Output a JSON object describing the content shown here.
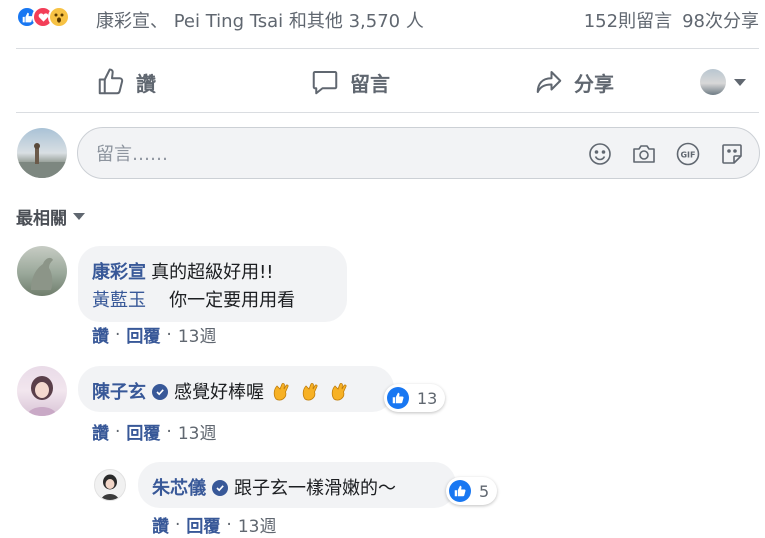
{
  "reactions": {
    "icons": [
      "like-icon",
      "love-icon",
      "wow-icon"
    ],
    "reactors_text": "康彩宣、 Pei Ting Tsai 和其他 3,570 人",
    "comments_count": "152則留言",
    "shares_count": "98次分享"
  },
  "actions": {
    "like": "讚",
    "comment": "留言",
    "share": "分享"
  },
  "composer": {
    "placeholder": "留言……"
  },
  "sort": {
    "label": "最相關"
  },
  "comments": [
    {
      "author": "康彩宣",
      "text": "真的超級好用!!",
      "mention": "黃藍玉",
      "mention_text": "你一定要用用看",
      "like_label": "讚",
      "reply_label": "回覆",
      "time": "13週"
    },
    {
      "author": "陳子玄",
      "verified": true,
      "text": "感覺好棒喔",
      "emoji": "clapping-hands-icon",
      "reactions_count": "13",
      "like_label": "讚",
      "reply_label": "回覆",
      "time": "13週",
      "replies": [
        {
          "author": "朱芯儀",
          "verified": true,
          "text": "跟子玄一樣滑嫩的～",
          "reactions_count": "5",
          "like_label": "讚",
          "reply_label": "回覆",
          "time": "13週"
        }
      ]
    }
  ],
  "colors": {
    "link": "#385898",
    "like_blue": "#1877f2",
    "bubble": "#f2f3f5",
    "muted": "#606770"
  }
}
